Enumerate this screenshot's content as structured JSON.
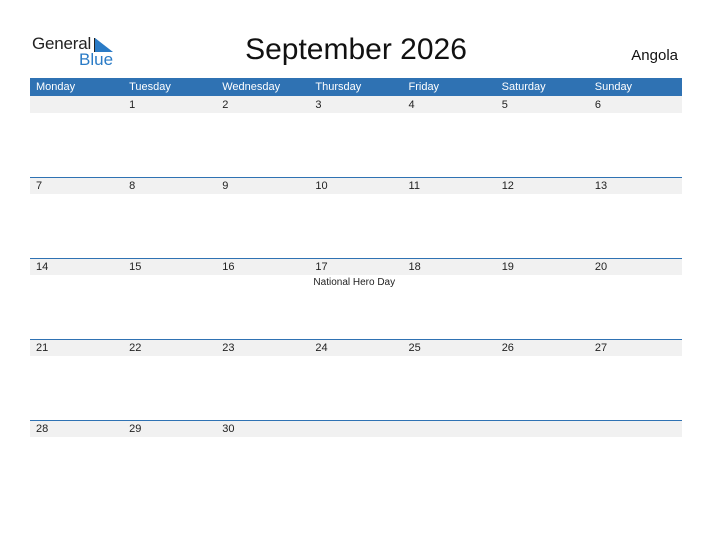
{
  "logo": {
    "word1": "General",
    "word2": "Blue"
  },
  "title": "September 2026",
  "country": "Angola",
  "colors": {
    "accent": "#2f72b3",
    "logo_blue": "#2a7bc6",
    "band": "#f1f1f1"
  },
  "weekdays": [
    "Monday",
    "Tuesday",
    "Wednesday",
    "Thursday",
    "Friday",
    "Saturday",
    "Sunday"
  ],
  "weeks": [
    {
      "days": [
        {
          "d": "",
          "e": ""
        },
        {
          "d": "1",
          "e": ""
        },
        {
          "d": "2",
          "e": ""
        },
        {
          "d": "3",
          "e": ""
        },
        {
          "d": "4",
          "e": ""
        },
        {
          "d": "5",
          "e": ""
        },
        {
          "d": "6",
          "e": ""
        }
      ]
    },
    {
      "days": [
        {
          "d": "7",
          "e": ""
        },
        {
          "d": "8",
          "e": ""
        },
        {
          "d": "9",
          "e": ""
        },
        {
          "d": "10",
          "e": ""
        },
        {
          "d": "11",
          "e": ""
        },
        {
          "d": "12",
          "e": ""
        },
        {
          "d": "13",
          "e": ""
        }
      ]
    },
    {
      "days": [
        {
          "d": "14",
          "e": ""
        },
        {
          "d": "15",
          "e": ""
        },
        {
          "d": "16",
          "e": ""
        },
        {
          "d": "17",
          "e": "National Hero Day"
        },
        {
          "d": "18",
          "e": ""
        },
        {
          "d": "19",
          "e": ""
        },
        {
          "d": "20",
          "e": ""
        }
      ]
    },
    {
      "days": [
        {
          "d": "21",
          "e": ""
        },
        {
          "d": "22",
          "e": ""
        },
        {
          "d": "23",
          "e": ""
        },
        {
          "d": "24",
          "e": ""
        },
        {
          "d": "25",
          "e": ""
        },
        {
          "d": "26",
          "e": ""
        },
        {
          "d": "27",
          "e": ""
        }
      ]
    },
    {
      "days": [
        {
          "d": "28",
          "e": ""
        },
        {
          "d": "29",
          "e": ""
        },
        {
          "d": "30",
          "e": ""
        },
        {
          "d": "",
          "e": ""
        },
        {
          "d": "",
          "e": ""
        },
        {
          "d": "",
          "e": ""
        },
        {
          "d": "",
          "e": ""
        }
      ]
    }
  ]
}
